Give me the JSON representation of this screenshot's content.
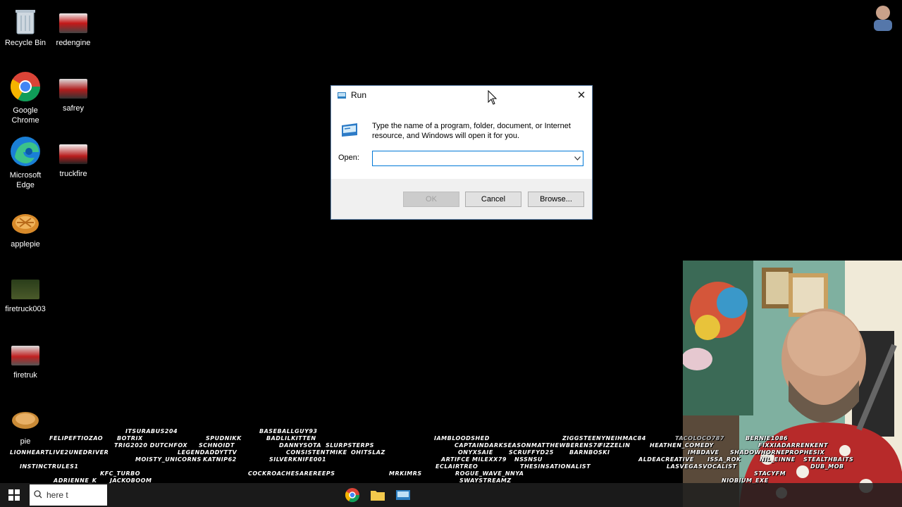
{
  "desktop": {
    "icons": [
      {
        "label": "Recycle Bin",
        "icon": "recycle-bin-icon"
      },
      {
        "label": "redengine",
        "icon": "fire-truck-thumbnail"
      },
      {
        "label": "Google Chrome",
        "icon": "chrome-icon"
      },
      {
        "label": "safrey",
        "icon": "fire-truck-thumbnail"
      },
      {
        "label": "Microsoft Edge",
        "icon": "edge-icon"
      },
      {
        "label": "truckfire",
        "icon": "fire-truck-thumbnail"
      },
      {
        "label": "applepie",
        "icon": "pie-thumbnail"
      },
      {
        "label": "firetruck003",
        "icon": "fire-truck-thumbnail"
      },
      {
        "label": "firetruk",
        "icon": "fire-truck-thumbnail"
      },
      {
        "label": "pie",
        "icon": "pie-thumbnail"
      }
    ]
  },
  "run_dialog": {
    "title": "Run",
    "description": "Type the name of a program, folder, document, or Internet resource, and Windows will open it for you.",
    "open_label": "Open:",
    "open_value": "",
    "buttons": {
      "ok": "OK",
      "cancel": "Cancel",
      "browse": "Browse..."
    },
    "close_glyph": "✕"
  },
  "taskbar": {
    "search_placeholder": "here t"
  },
  "chatters": [
    "ITSURABUS204",
    "BASEBALLGUY93",
    "FELIPEFTIOZAO",
    "BOTRIX",
    "SPUDNIKK",
    "BADLILKITTEN",
    "TRIG2020 DUTCHFOX",
    "SCHNOIDT",
    "DANNYSOTA",
    "SLURPSTERPS",
    "LIONHEARTLIVE2UNEDRIVER",
    "LEGENDADDYTTV",
    "CONSISTENTMIKE",
    "OHITSLAZ",
    "MOISTY_UNICORNS",
    "KATNIP62",
    "SILVERKNIFE001",
    "INSTINCTRULES1",
    "KFC_TURBO",
    "COCKROACHESAREREEPS",
    "MRKIMRS",
    "ADRIENNE_K",
    "JACKOBOOM",
    "IAMBLOODSHED",
    "CAPTAINDARKSEASON",
    "ONYXSAIE",
    "MATTHEWBERENS78",
    "FIZZELIN",
    "SCRUFFYD25",
    "ZIGGSTEENYNEIHMAC84",
    "BARNBOSKI",
    "TACOLOCO787",
    "BERNIE1086",
    "HEATHEN_COMEDY",
    "FIXXIADARRENKENT",
    "ARTIFCE",
    "MILEXX79",
    "NSSNSU",
    "ECLAIRTREO",
    "THESINSATIONALIST",
    "IMBDAVE",
    "SHADOWHORNET3",
    "PROPHESIX",
    "ROGUE_WAVE_NNYA",
    "SWAYSTREAMZ",
    "ALDEACREATIVE",
    "ISSA_ROK",
    "NIL_EINNE",
    "STEALTHBAITS",
    "LASVEGASVOCALIST",
    "DUB_MOB",
    "STACYFM",
    "NIOBIUM_EXE"
  ]
}
